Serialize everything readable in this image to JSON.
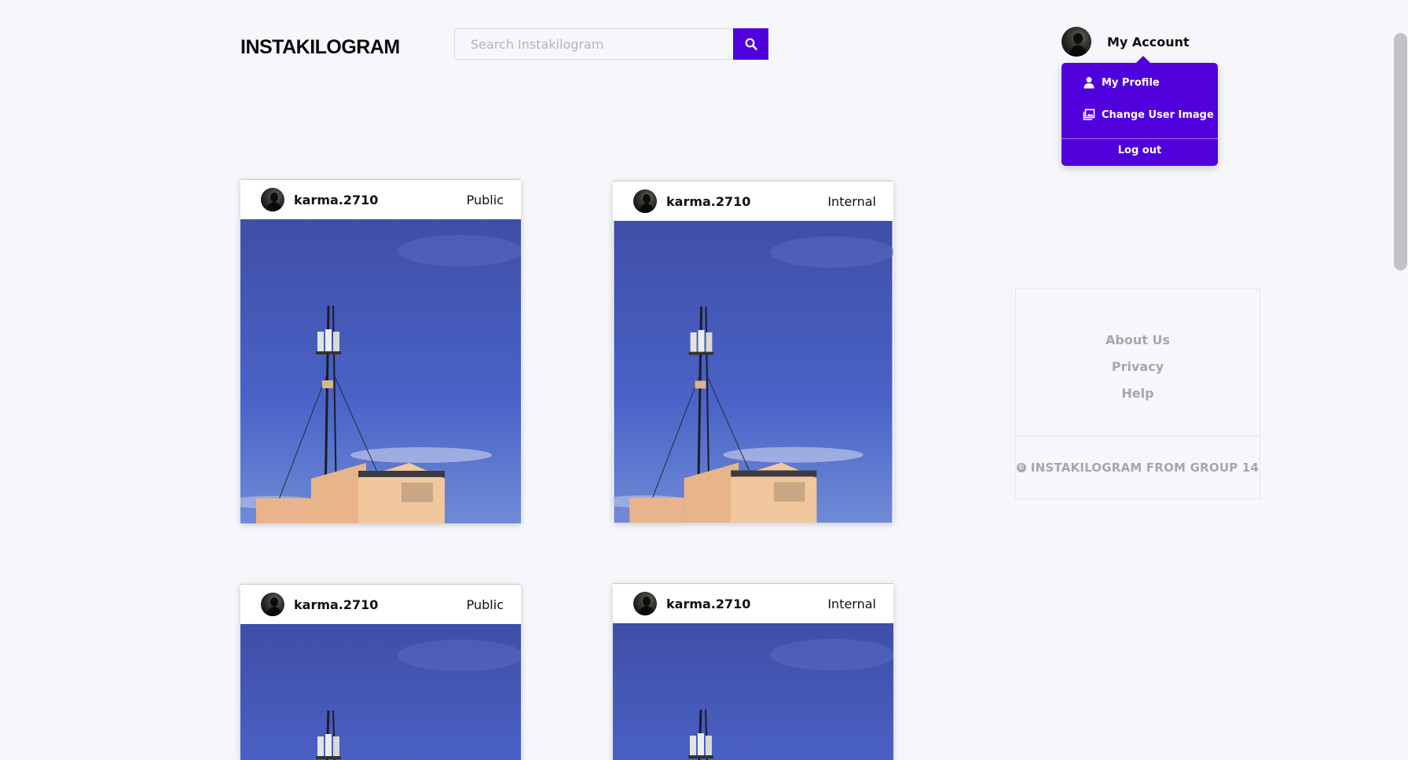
{
  "app": {
    "logo": "INSTAKILOGRAM"
  },
  "search": {
    "placeholder": "Search Instakilogram"
  },
  "account": {
    "label": "My Account",
    "menu": [
      {
        "label": "My Profile",
        "icon": "user-icon"
      },
      {
        "label": "Change User Image",
        "icon": "image-icon"
      }
    ],
    "logout_label": "Log out"
  },
  "posts": [
    {
      "username": "karma.2710",
      "visibility": "Public"
    },
    {
      "username": "karma.2710",
      "visibility": "Internal"
    },
    {
      "username": "karma.2710",
      "visibility": "Public"
    },
    {
      "username": "karma.2710",
      "visibility": "Internal"
    }
  ],
  "sidebar": {
    "links": [
      "About Us",
      "Privacy",
      "Help"
    ],
    "footer": "INSTAKILOGRAM FROM GROUP 14"
  },
  "colors": {
    "accent": "#5000db",
    "background": "#f6f7fa",
    "muted_text": "#a6a6ad"
  }
}
